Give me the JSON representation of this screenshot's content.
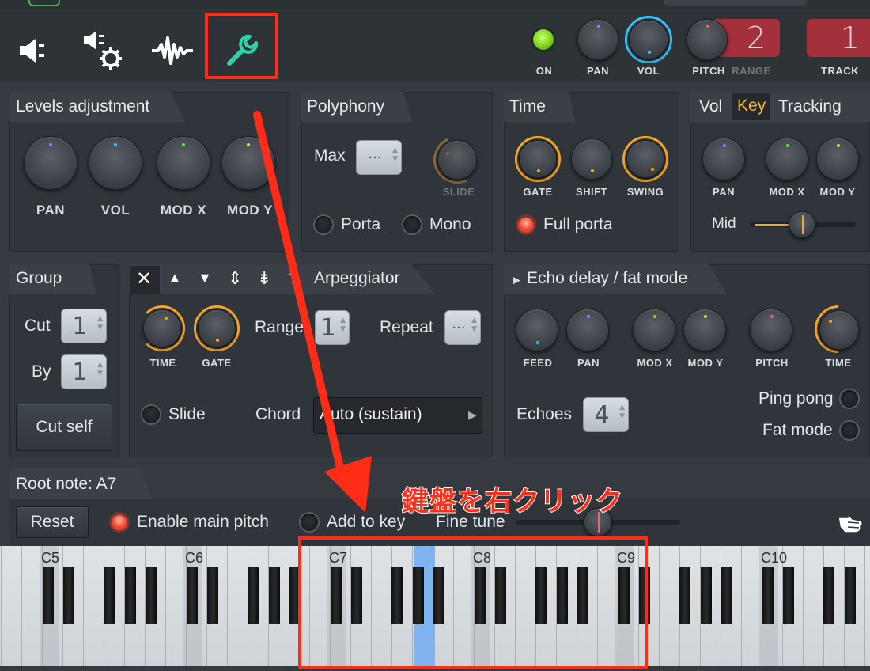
{
  "toolbar": {
    "icons": [
      "speaker-plug-icon",
      "speaker-gear-icon",
      "waveform-icon",
      "wrench-icon"
    ],
    "on_label": "ON",
    "pan_label": "PAN",
    "vol_label": "VOL",
    "pitch_label": "PITCH",
    "range_label": "RANGE",
    "range_value": "2",
    "track_label": "TRACK",
    "track_value": "1"
  },
  "levels": {
    "title": "Levels adjustment",
    "knobs": [
      "PAN",
      "VOL",
      "MOD X",
      "MOD Y"
    ]
  },
  "polyphony": {
    "title": "Polyphony",
    "max_label": "Max",
    "max_value": "···",
    "slide_label": "SLIDE",
    "porta_label": "Porta",
    "mono_label": "Mono"
  },
  "time": {
    "title": "Time",
    "knobs": [
      "GATE",
      "SHIFT",
      "SWING"
    ],
    "full_porta_label": "Full porta"
  },
  "tracking": {
    "title_vol": "Vol",
    "title_key": "Key",
    "title_tracking": "Tracking",
    "knobs": [
      "PAN",
      "MOD X",
      "MOD Y"
    ],
    "mid_label": "Mid"
  },
  "group": {
    "title": "Group",
    "cut_label": "Cut",
    "cut_value": "1",
    "by_label": "By",
    "by_value": "1",
    "cut_self_label": "Cut self"
  },
  "arpeggiator": {
    "title": "Arpeggiator",
    "icon_glyphs": [
      "✕",
      "▲",
      "▼",
      "⇕",
      "⇟",
      "?"
    ],
    "time_label": "TIME",
    "gate_label": "GATE",
    "range_label": "Range",
    "range_value": "1",
    "repeat_label": "Repeat",
    "repeat_value": "···",
    "slide_label": "Slide",
    "chord_label": "Chord",
    "chord_value": "Auto (sustain)"
  },
  "echo": {
    "title": "Echo delay / fat mode",
    "knobs": [
      "FEED",
      "PAN",
      "MOD X",
      "MOD Y",
      "PITCH",
      "TIME"
    ],
    "echoes_label": "Echoes",
    "echoes_value": "4",
    "ping_pong_label": "Ping pong",
    "fat_mode_label": "Fat mode"
  },
  "root": {
    "title": "Root note: A7",
    "reset_label": "Reset",
    "enable_main_pitch_label": "Enable main pitch",
    "add_to_key_label": "Add to key",
    "fine_tune_label": "Fine tune"
  },
  "keyboard": {
    "octaves": [
      "C5",
      "C6",
      "C7",
      "C8",
      "C9",
      "C10"
    ],
    "highlight_color": "#7fb4f0"
  },
  "annotation": {
    "caption": "鍵盤を右クリック",
    "color": "#ff2d17"
  }
}
